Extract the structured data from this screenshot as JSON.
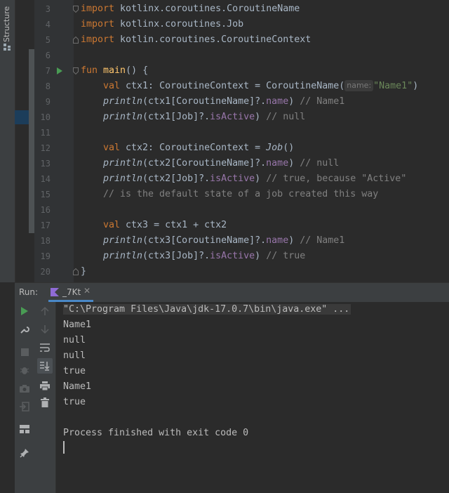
{
  "sidebar": {
    "structure_label": "Structure"
  },
  "editor": {
    "lines": [
      {
        "n": "3"
      },
      {
        "n": "4"
      },
      {
        "n": "5"
      },
      {
        "n": "6"
      },
      {
        "n": "7"
      },
      {
        "n": "8"
      },
      {
        "n": "9"
      },
      {
        "n": "10"
      },
      {
        "n": "11"
      },
      {
        "n": "12"
      },
      {
        "n": "13"
      },
      {
        "n": "14"
      },
      {
        "n": "15"
      },
      {
        "n": "16"
      },
      {
        "n": "17"
      },
      {
        "n": "18"
      },
      {
        "n": "19"
      },
      {
        "n": "20"
      }
    ],
    "code": {
      "l3": {
        "kw": "import",
        "rest": " kotlinx.coroutines.CoroutineName"
      },
      "l4": {
        "kw": "import",
        "rest": " kotlinx.coroutines.Job"
      },
      "l5": {
        "kw": "import",
        "rest": " kotlin.coroutines.CoroutineContext"
      },
      "l7": {
        "kw": "fun",
        "fn": " main",
        "rest": "() {"
      },
      "l8": {
        "kw": "val",
        "a": " ctx1: CoroutineContext = CoroutineName(",
        "hint": "name:",
        "str": "\"Name1\"",
        "b": ")"
      },
      "l9": {
        "fn": "println",
        "a": "(ctx1[CoroutineName]?.",
        "prop": "name",
        "b": ") ",
        "cm": "// Name1"
      },
      "l10": {
        "fn": "println",
        "a": "(ctx1[Job]?.",
        "prop": "isActive",
        "b": ") ",
        "cm": "// null"
      },
      "l12": {
        "kw": "val",
        "a": " ctx2: CoroutineContext = ",
        "it": "Job",
        "b": "()"
      },
      "l13": {
        "fn": "println",
        "a": "(ctx2[CoroutineName]?.",
        "prop": "name",
        "b": ") ",
        "cm": "// null"
      },
      "l14": {
        "fn": "println",
        "a": "(ctx2[Job]?.",
        "prop": "isActive",
        "b": ") ",
        "cm": "// true, because \"Active\""
      },
      "l15": {
        "cm": "// is the default state of a job created this way"
      },
      "l17": {
        "kw": "val",
        "a": " ctx3 = ctx1 + ctx2"
      },
      "l18": {
        "fn": "println",
        "a": "(ctx3[CoroutineName]?.",
        "prop": "name",
        "b": ") ",
        "cm": "// Name1"
      },
      "l19": {
        "fn": "println",
        "a": "(ctx3[Job]?.",
        "prop": "isActive",
        "b": ") ",
        "cm": "// true"
      },
      "l20": {
        "rest": "}"
      }
    }
  },
  "run": {
    "label": "Run:",
    "tab_name": "_7Kt",
    "tab_close": "✕",
    "output": {
      "command": "\"C:\\Program Files\\Java\\jdk-17.0.7\\bin\\java.exe\" ...",
      "lines": [
        "Name1",
        "null",
        "null",
        "true",
        "Name1",
        "true"
      ],
      "finished": "Process finished with exit code 0"
    }
  },
  "colors": {
    "keyword": "#cc7832",
    "function": "#ffc66d",
    "property": "#9876aa",
    "string": "#6a8759",
    "comment": "#808080",
    "run_green": "#499c54",
    "tab_underline": "#4a88c7"
  },
  "icons": [
    "structure-icon",
    "run-gutter-icon",
    "fold-icon",
    "kotlin-file-icon",
    "rerun-icon",
    "wrench-icon",
    "stop-icon",
    "debug-icon",
    "camera-icon",
    "exit-icon",
    "layout-icon",
    "pin-icon",
    "up-arrow-icon",
    "down-arrow-icon",
    "soft-wrap-icon",
    "scroll-to-end-icon",
    "print-icon",
    "trash-icon"
  ]
}
